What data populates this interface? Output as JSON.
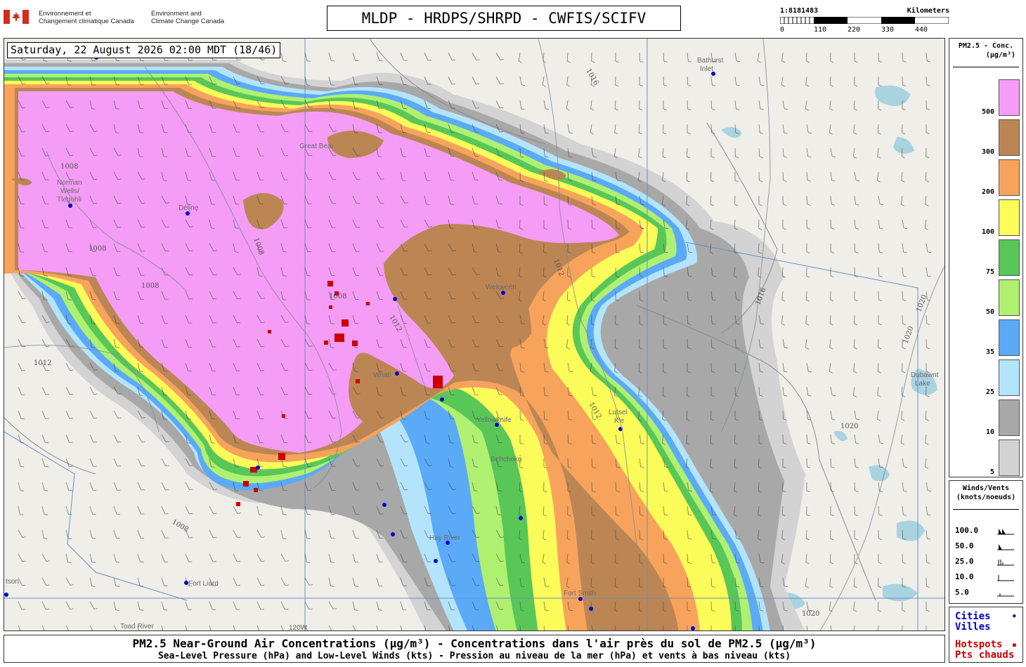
{
  "header": {
    "agency_fr_line1": "Environnement et",
    "agency_fr_line2": "Changement climatique Canada",
    "agency_en_line1": "Environment and",
    "agency_en_line2": "Climate Change Canada",
    "title": "MLDP - HRDPS/SHRPD - CWFIS/SCIFV"
  },
  "scale": {
    "ratio": "1:8181483",
    "unit": "Kilometers",
    "ticks": [
      "0",
      "110",
      "220",
      "330",
      "440"
    ]
  },
  "map": {
    "timestamp": "Saturday, 22 August 2026 02:00 MDT (18/46)",
    "places": [
      {
        "name": "Bathurst"
      },
      {
        "name": "Inlet"
      },
      {
        "name": "Norman"
      },
      {
        "name": "Wells/"
      },
      {
        "name": "Tlegohli"
      },
      {
        "name": "Délįnę"
      },
      {
        "name": "Wekweètì"
      },
      {
        "name": "Whatì"
      },
      {
        "name": "Yellowknife"
      },
      {
        "name": "Lutsel"
      },
      {
        "name": "K'e"
      },
      {
        "name": "Hay River"
      },
      {
        "name": "Fort Liard"
      },
      {
        "name": "Fort Smith"
      },
      {
        "name": "Toad River"
      },
      {
        "name": "Dubawnt"
      },
      {
        "name": "Lake"
      },
      {
        "name": "Great Bear"
      },
      {
        "name": "tson"
      },
      {
        "name": "Behchokǫ̀"
      }
    ],
    "longitude_label": "120W",
    "isobars": [
      "1016",
      "1008",
      "1008",
      "1008",
      "1008",
      "1008",
      "1012",
      "1012",
      "1016",
      "1020",
      "1020",
      "1020",
      "1020",
      "1008",
      "1012",
      "1012"
    ]
  },
  "legend": {
    "title_line1": "PM2.5 - Conc.",
    "title_line2": "(µg/m³)",
    "items": [
      {
        "label": "500",
        "color": "#f59cf6"
      },
      {
        "label": "300",
        "color": "#bc8654"
      },
      {
        "label": "200",
        "color": "#f7a35c"
      },
      {
        "label": "100",
        "color": "#fbfb5a"
      },
      {
        "label": "75",
        "color": "#58c758"
      },
      {
        "label": "50",
        "color": "#b0f070"
      },
      {
        "label": "35",
        "color": "#5aaaf8"
      },
      {
        "label": "25",
        "color": "#b3e4fb"
      },
      {
        "label": "10",
        "color": "#a8a8a8"
      },
      {
        "label": "5",
        "color": "#d3d3d3"
      }
    ]
  },
  "winds": {
    "title_line1": "Winds/Vents",
    "title_line2": "(knots/noeuds)",
    "items": [
      "100.0",
      "50.0",
      "25.0",
      "10.0",
      "5.0"
    ]
  },
  "symbols": {
    "cities_line1": "Cities",
    "cities_line2": "Villes",
    "cities_marker": "•",
    "hotspots_line1": "Hotspots",
    "hotspots_line2": "Pts chauds",
    "hotspots_marker": "▪"
  },
  "footer": {
    "main": "PM2.5 Near-Ground Air Concentrations (µg/m³) - Concentrations dans l'air près du sol de PM2.5 (µg/m³)",
    "sub": "Sea-Level Pressure (hPa) and Low-Level Winds (kts) - Pression au niveau de la mer (hPa) et vents à bas niveau (kts)"
  },
  "colors": {
    "cities": "#0000cc",
    "hotspots": "#cc0000",
    "water": "#a9d3df",
    "land": "#efeee9"
  }
}
